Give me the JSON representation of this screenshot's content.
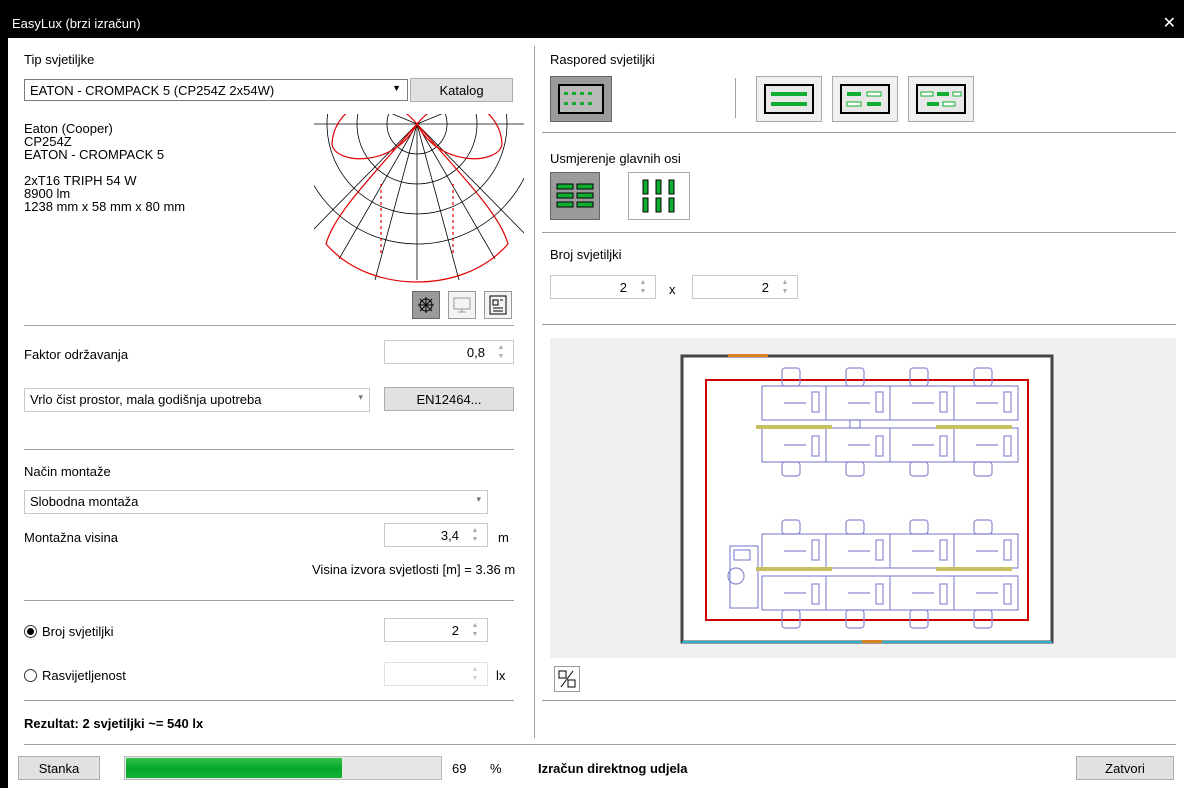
{
  "window": {
    "title": "EasyLux (brzi izračun)",
    "close_glyph": "✕"
  },
  "luminaire": {
    "section_label": "Tip svjetiljke",
    "selected": "EATON - CROMPACK 5 (CP254Z 2x54W)",
    "catalog_button": "Katalog",
    "manufacturer": "Eaton (Cooper)",
    "code": "CP254Z",
    "name": "EATON - CROMPACK 5",
    "lamp": "2xT16 TRIPH 54 W",
    "flux": "8900 lm",
    "dimensions": "1238 mm x 58 mm x 80 mm",
    "view_icons": [
      "polar-diagram-icon",
      "monitor-icon",
      "datasheet-icon"
    ]
  },
  "maintenance": {
    "label": "Faktor održavanja",
    "value": "0,8",
    "condition": "Vrlo čist prostor, mala godišnja upotreba",
    "standard_button": "EN12464..."
  },
  "mounting": {
    "section_label": "Način montaže",
    "type": "Slobodna montaža",
    "height_label": "Montažna visina",
    "height_value": "3,4",
    "height_unit": "m",
    "source_height_text": "Visina izvora svjetlosti [m] = 3.36 m"
  },
  "calc_mode": {
    "count_label": "Broj svjetiljki",
    "count_value": "2",
    "illuminance_label": "Rasvijetljenost",
    "illuminance_value": "",
    "illuminance_unit": "lx",
    "selected": "count"
  },
  "result": {
    "text": "Rezultat: 2 svjetiljki ~= 540 lx"
  },
  "arrangement": {
    "label": "Raspored svjetiljki",
    "options": [
      "grid-layout-icon",
      "rows-layout-icon",
      "offset-layout-icon",
      "staggered-layout-icon"
    ],
    "selected_index": 0
  },
  "orientation": {
    "label": "Usmjerenje glavnih osi",
    "options": [
      "horizontal-axis-icon",
      "vertical-axis-icon"
    ],
    "selected_index": 0
  },
  "count": {
    "label": "Broj svjetiljki",
    "x": "2",
    "sep": "x",
    "y": "2"
  },
  "statusbar": {
    "pause_button": "Stanka",
    "progress_percent": 69,
    "progress_text": "69",
    "percent_sign": "%",
    "status_text": "Izračun direktnog udjela",
    "close_button": "Zatvori"
  },
  "colors": {
    "accent_green": "#0fae32",
    "selected_button": "#9b9b9b",
    "room_outline": "#d00000",
    "furniture": "#8a8ad6",
    "luminaire_fill": "#c8c060"
  }
}
